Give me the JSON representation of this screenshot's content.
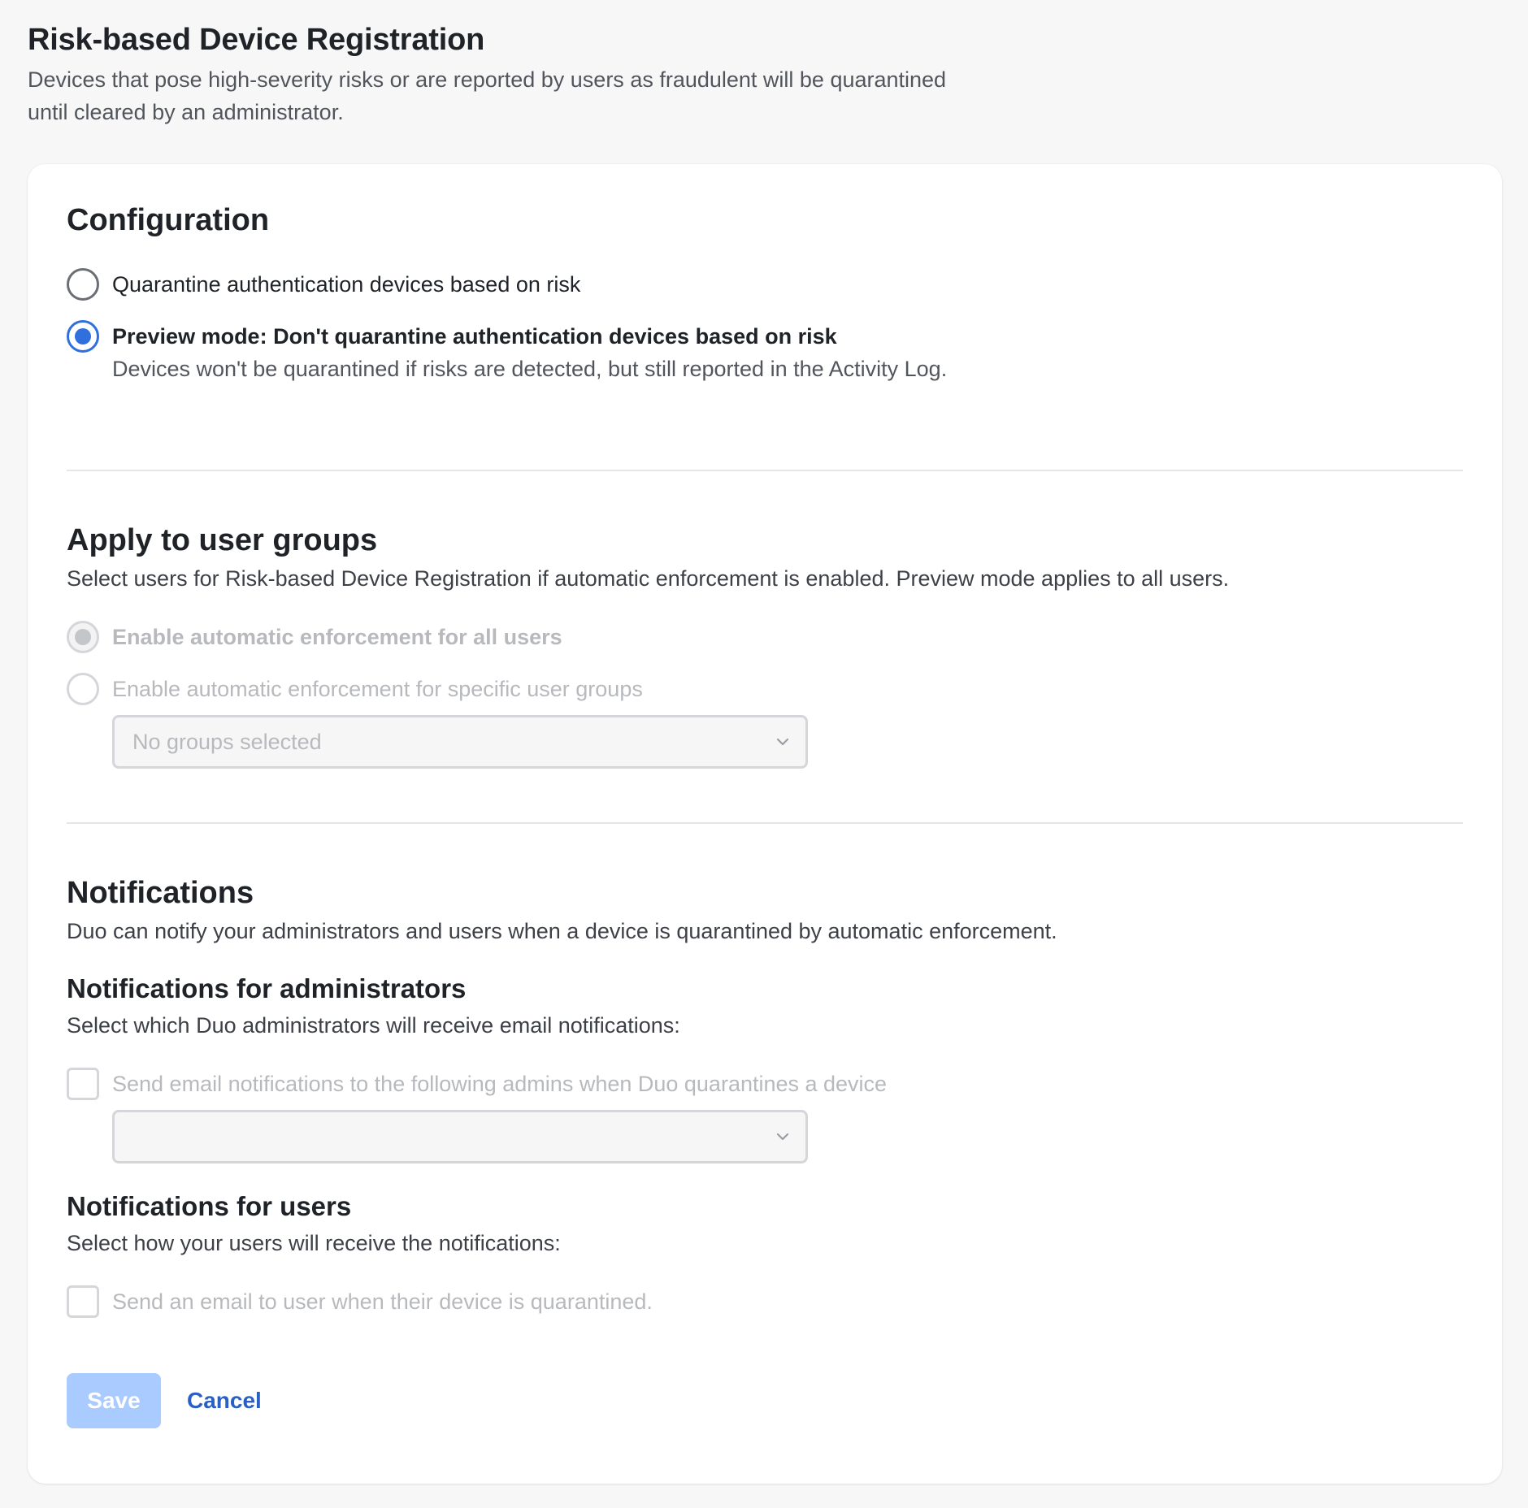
{
  "header": {
    "title": "Risk-based Device Registration",
    "description": "Devices that pose high-severity risks or are reported by users as fraudulent will be quarantined until cleared by an administrator."
  },
  "configuration": {
    "title": "Configuration",
    "options": [
      {
        "label": "Quarantine authentication devices based on risk",
        "selected": false
      },
      {
        "label": "Preview mode: Don't quarantine authentication devices based on risk",
        "help": "Devices won't be quarantined if risks are detected, but still reported in the Activity Log.",
        "selected": true
      }
    ]
  },
  "user_groups": {
    "title": "Apply to user groups",
    "description": "Select users for Risk-based Device Registration if automatic enforcement is enabled. Preview mode applies to all users.",
    "options": [
      {
        "label": "Enable automatic enforcement for all users",
        "selected": true,
        "disabled": true
      },
      {
        "label": "Enable automatic enforcement for specific user groups",
        "selected": false,
        "disabled": true
      }
    ],
    "groups_select": {
      "value": "No groups selected",
      "disabled": true
    }
  },
  "notifications": {
    "title": "Notifications",
    "description": "Duo can notify your administrators and users when a device is quarantined by automatic enforcement.",
    "admins": {
      "title": "Notifications for administrators",
      "description": "Select which Duo administrators will receive email notifications:",
      "checkbox_label": "Send email notifications to the following admins when Duo quarantines a device",
      "checked": false,
      "select_value": ""
    },
    "users": {
      "title": "Notifications for users",
      "description": "Select how your users will receive the notifications:",
      "checkbox_label": "Send an email to user when their device is quarantined.",
      "checked": false
    }
  },
  "actions": {
    "save_label": "Save",
    "cancel_label": "Cancel"
  },
  "colors": {
    "accent": "#2f6fde",
    "save_disabled": "#a9cbff",
    "link": "#2a5fc4",
    "background": "#f7f7f7"
  }
}
